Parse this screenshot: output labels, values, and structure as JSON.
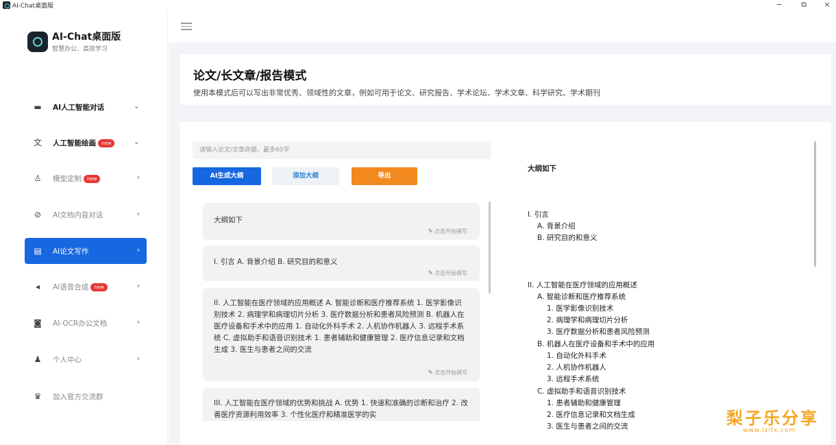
{
  "window": {
    "title": "AI-Chat桌面版",
    "minimize_glyph": "−",
    "maximize_glyph": "⧉",
    "close_glyph": "×"
  },
  "sidebar": {
    "brand_name": "AI-Chat桌面版",
    "brand_sub": "智慧办公、高效学习",
    "items": [
      {
        "label": "AI人工智能对话",
        "icon": "chat-icon",
        "glyph": "▬",
        "badge": "",
        "arrow": "⌄"
      },
      {
        "label": "人工智能绘画",
        "icon": "translate-icon",
        "glyph": "文",
        "badge": "new",
        "arrow": "⌄"
      },
      {
        "label": "模型定制",
        "icon": "flask-icon",
        "glyph": "♙",
        "badge": "new",
        "arrow": "›"
      },
      {
        "label": "AI文档内容对话",
        "icon": "compass-icon",
        "glyph": "⊘",
        "badge": "",
        "arrow": "›"
      },
      {
        "label": "AI论文写作",
        "icon": "document-icon",
        "glyph": "▤",
        "badge": "",
        "arrow": "›"
      },
      {
        "label": "AI语音合成",
        "icon": "speaker-icon",
        "glyph": "◂",
        "badge": "new",
        "arrow": "›"
      },
      {
        "label": "AI-OCR办公文档",
        "icon": "camera-icon",
        "glyph": "◙",
        "badge": "",
        "arrow": "›"
      },
      {
        "label": "个人中心",
        "icon": "user-icon",
        "glyph": "♟",
        "badge": "",
        "arrow": "›"
      },
      {
        "label": "加入官方交流群",
        "icon": "crown-icon",
        "glyph": "♛",
        "badge": "",
        "arrow": ""
      }
    ]
  },
  "header": {
    "title": "论文/长文章/报告模式",
    "description": "使用本模式后可以写出非常优秀、领域性的文章，例如可用于论文、研究报告、学术论坛、学术文章、科学研究、学术期刊"
  },
  "form": {
    "topic_placeholder": "请输入论文/文章命题，最多60字",
    "generate_button": "AI生成大纲",
    "add_button": "添加大纲",
    "export_button": "导出"
  },
  "sections": [
    {
      "text": "大纲如下",
      "edit": "点击开始撰写"
    },
    {
      "text": "I. 引言 A. 背景介绍 B. 研究目的和意义",
      "edit": "点击开始撰写"
    },
    {
      "text": "II. 人工智能在医疗领域的应用概述 A. 智能诊断和医疗推荐系统 1. 医学影像识别技术 2. 病理学和病理切片分析 3. 医疗数据分析和患者风险预测 B. 机器人在医疗设备和手术中的应用 1. 自动化外科手术 2. 人机协作机器人 3. 远程手术系统 C. 虚拟助手和语音识别技术 1. 患者辅助和健康管理 2. 医疗信息记录和文档生成 3. 医生与患者之间的交流",
      "edit": "点击开始撰写"
    },
    {
      "text": "III. 人工智能在医疗领域的优势和挑战 A. 优势 1. 快速和准确的诊断和治疗 2. 改善医疗资源利用效率 3. 个性化医疗和精准医学的实",
      "edit": ""
    }
  ],
  "outline": [
    "大纲如下",
    "I. 引言",
    "A. 背景介绍",
    "B. 研究目的和意义",
    "II. 人工智能在医疗领域的应用概述",
    "A. 智能诊断和医疗推荐系统",
    "1. 医学影像识别技术",
    "2. 病理学和病理切片分析",
    "3. 医疗数据分析和患者风险预测",
    "B. 机器人在医疗设备和手术中的应用",
    "1. 自动化外科手术",
    "2. 人机协作机器人",
    "3. 远程手术系统",
    "C. 虚拟助手和语音识别技术",
    "1. 患者辅助和健康管理",
    "2. 医疗信息记录和文档生成",
    "3. 医生与患者之间的交流"
  ],
  "watermark": {
    "text": "梨子乐分享",
    "url": "www.lzlfx.com"
  },
  "colors": {
    "primary": "#1667e0",
    "export": "#f2891e",
    "badge": "#e53935",
    "watermark": "#f5a623"
  }
}
